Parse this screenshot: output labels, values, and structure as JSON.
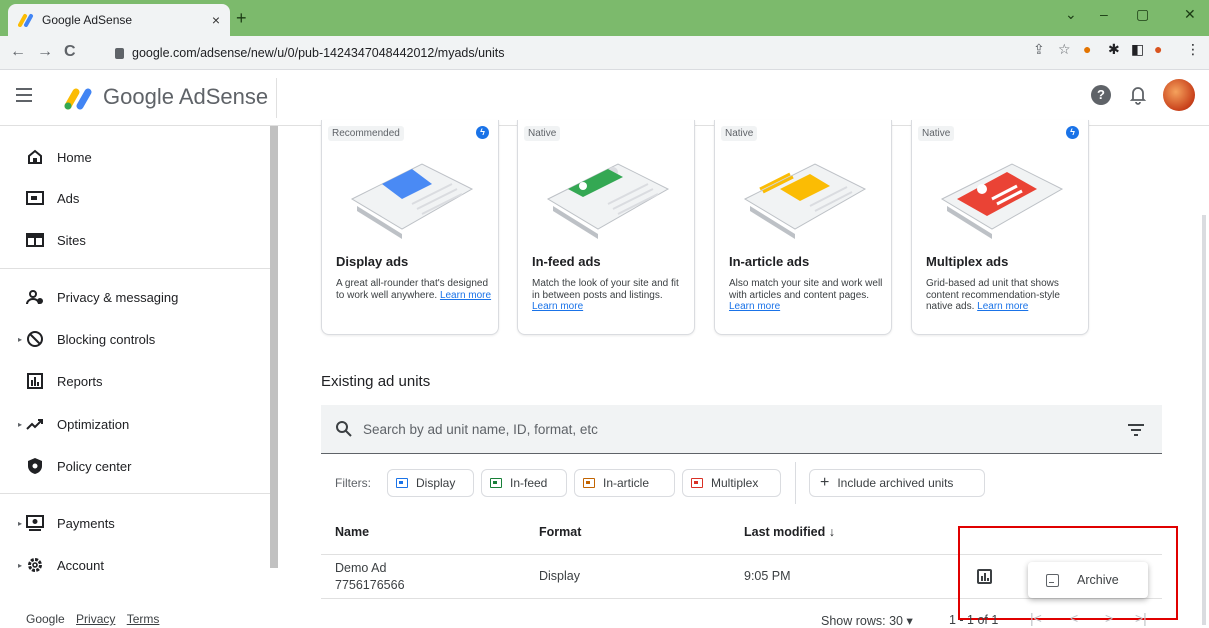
{
  "browser": {
    "tab_title": "Google AdSense",
    "tab_close": "×",
    "new_tab": "+",
    "url": "google.com/adsense/new/u/0/pub-1424347048442012/myads/units",
    "window_controls": [
      "⌄",
      "–",
      "▢",
      "✕"
    ]
  },
  "header": {
    "brand": "Google AdSense",
    "help": "?"
  },
  "sidebar": {
    "items": [
      {
        "label": "Home",
        "icon": "home-icon"
      },
      {
        "label": "Ads",
        "icon": "ads-icon"
      },
      {
        "label": "Sites",
        "icon": "sites-icon"
      },
      {
        "label": "Privacy & messaging",
        "icon": "privacy-icon"
      },
      {
        "label": "Blocking controls",
        "icon": "block-icon"
      },
      {
        "label": "Reports",
        "icon": "reports-icon"
      },
      {
        "label": "Optimization",
        "icon": "trend-icon"
      },
      {
        "label": "Policy center",
        "icon": "policy-icon"
      },
      {
        "label": "Payments",
        "icon": "payments-icon"
      },
      {
        "label": "Account",
        "icon": "gear-icon"
      }
    ],
    "footer": {
      "google": "Google",
      "privacy": "Privacy",
      "terms": "Terms"
    }
  },
  "cards": [
    {
      "chip": "Recommended",
      "bolt": true,
      "title": "Display ads",
      "desc": "A great all-rounder that's designed to work well anywhere. ",
      "link": "Learn more",
      "color": "#4a8af4"
    },
    {
      "chip": "Native",
      "bolt": false,
      "title": "In-feed ads",
      "desc": "Match the look of your site and fit in between posts and listings. ",
      "link": "Learn more",
      "color": "#34a853"
    },
    {
      "chip": "Native",
      "bolt": false,
      "title": "In-article ads",
      "desc": "Also match your site and work well with articles and content pages. ",
      "link": "Learn more",
      "color": "#fbbc04"
    },
    {
      "chip": "Native",
      "bolt": true,
      "title": "Multiplex ads",
      "desc": "Grid-based ad unit that shows content recommendation-style native ads. ",
      "link": "Learn more",
      "color": "#ea4335"
    }
  ],
  "existing": {
    "title": "Existing ad units",
    "search_placeholder": "Search by ad unit name, ID, format, etc",
    "filters_label": "Filters:",
    "filters": [
      {
        "label": "Display",
        "color": "#1a73e8"
      },
      {
        "label": "In-feed",
        "color": "#188038"
      },
      {
        "label": "In-article",
        "color": "#c26401"
      },
      {
        "label": "Multiplex",
        "color": "#d93025"
      }
    ],
    "include_archived": "Include archived units",
    "include_plus": "+",
    "columns": {
      "name": "Name",
      "format": "Format",
      "modified": "Last modified ↓"
    },
    "rows": [
      {
        "name": "Demo Ad",
        "id": "7756176566",
        "format": "Display",
        "modified": "9:05 PM"
      }
    ],
    "menu_item": "Archive",
    "pager": {
      "label": "Show rows:",
      "rows": "30 ▾",
      "count": "1 - 1 of 1"
    }
  }
}
